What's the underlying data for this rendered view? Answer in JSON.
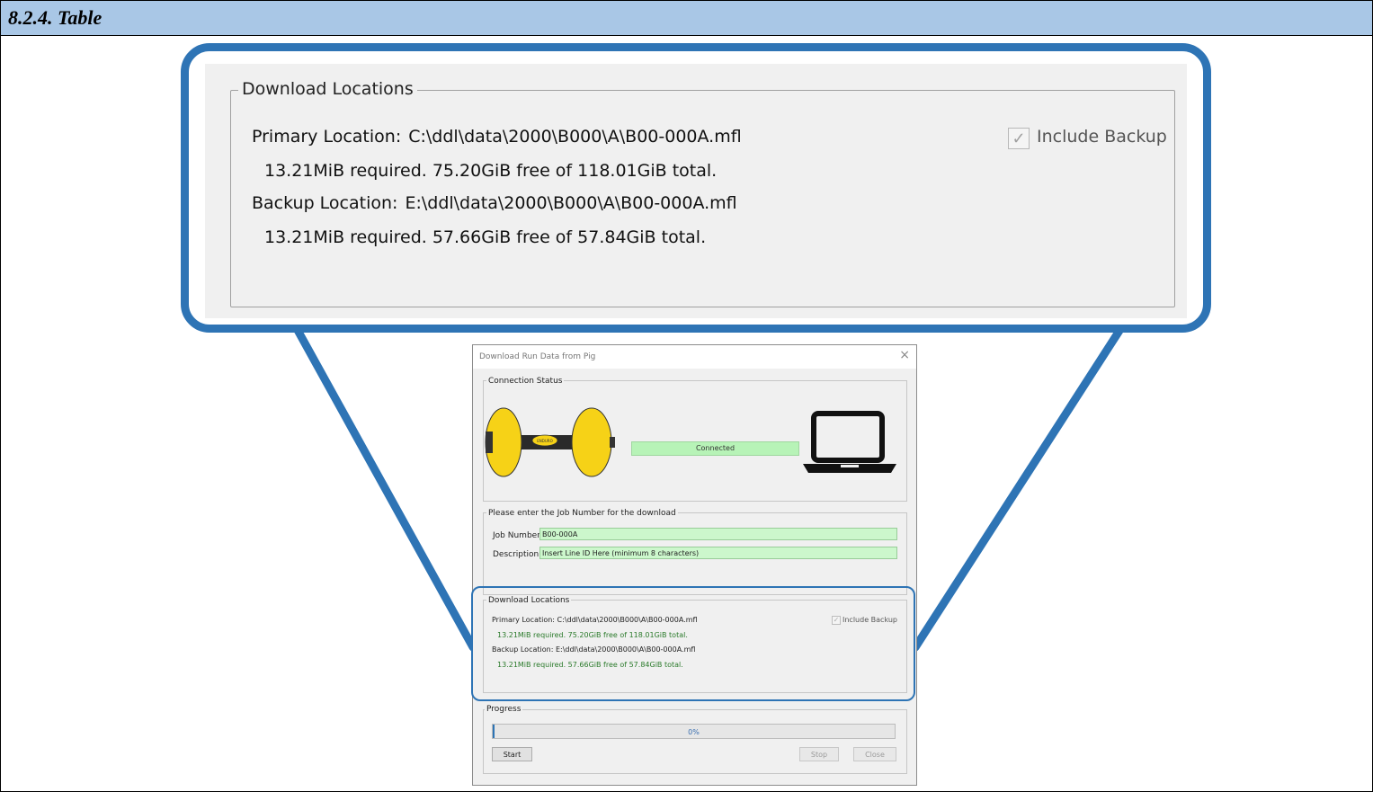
{
  "page": {
    "section_title": "8.2.4. Table"
  },
  "callout": {
    "group_title": "Download Locations",
    "primary_label": "Primary Location:",
    "primary_path": "C:\\ddl\\data\\2000\\B000\\A\\B00-000A.mfl",
    "primary_space": "13.21MiB required. 75.20GiB free of 118.01GiB total.",
    "backup_label": "Backup Location:",
    "backup_path": "E:\\ddl\\data\\2000\\B000\\A\\B00-000A.mfl",
    "backup_space": "13.21MiB required. 57.66GiB free of 57.84GiB total.",
    "include_backup_label": "Include Backup",
    "include_backup_checked": true
  },
  "dialog": {
    "title": "Download Run Data from Pig",
    "close_glyph": "×",
    "connection": {
      "group_title": "Connection Status",
      "status_text": "Connected",
      "pig_badge": "ENDURO"
    },
    "job": {
      "group_title": "Please enter the Job Number for the download",
      "job_number_label": "Job Number:",
      "job_number_value": "B00-000A",
      "description_label": "Description:",
      "description_value": "Insert Line ID Here (minimum 8 characters)"
    },
    "locations": {
      "group_title": "Download Locations",
      "primary_label": "Primary Location:",
      "primary_path": "C:\\ddl\\data\\2000\\B000\\A\\B00-000A.mfl",
      "primary_space": "13.21MiB required. 75.20GiB free of 118.01GiB total.",
      "backup_label": "Backup Location:",
      "backup_path": "E:\\ddl\\data\\2000\\B000\\A\\B00-000A.mfl",
      "backup_space": "13.21MiB required. 57.66GiB free of 57.84GiB total.",
      "include_backup_label": "Include Backup"
    },
    "progress": {
      "group_title": "Progress",
      "value_percent": 0,
      "value_text": "0%"
    },
    "buttons": {
      "start": "Start",
      "stop": "Stop",
      "close": "Close"
    }
  },
  "colors": {
    "accent": "#2e74b5",
    "field_green": "#ccf7cc",
    "heading_bar": "#a9c7e6",
    "pig_yellow": "#f6d217"
  }
}
